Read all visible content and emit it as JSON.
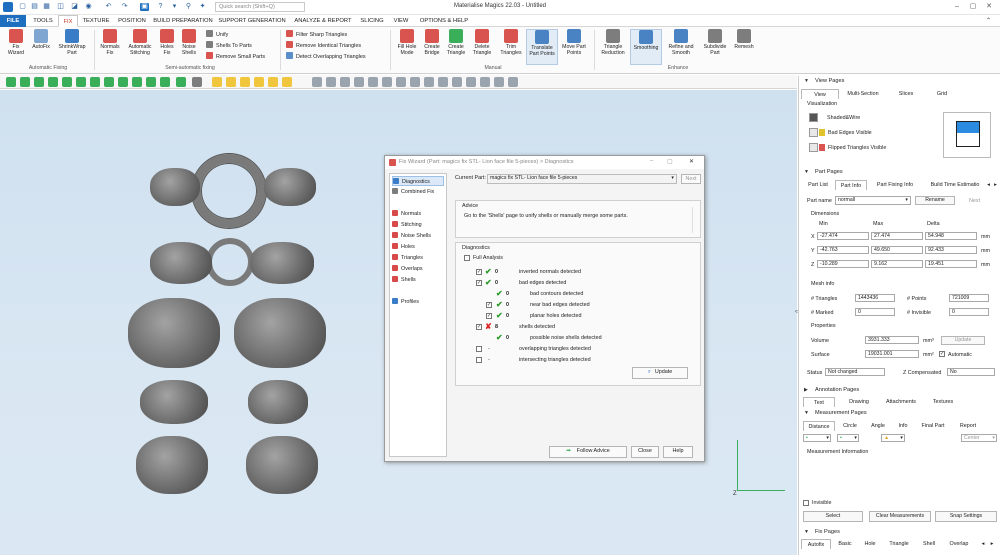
{
  "app": {
    "title": "Materialise Magics 22.03 - Untitled",
    "search_placeholder": "Quick search (Shift+Q)"
  },
  "menu_tabs": [
    "FILE",
    "TOOLS",
    "FIX",
    "TEXTURE",
    "POSITION",
    "BUILD PREPARATION",
    "SUPPORT GENERATION",
    "ANALYZE & REPORT",
    "SLICING",
    "VIEW",
    "OPTIONS & HELP"
  ],
  "ribbon": {
    "auto": [
      "Fix Wizard",
      "AutoFix",
      "ShrinkWrap Part"
    ],
    "auto_group": "Automatic Fixing",
    "semi": [
      "Normals Fix",
      "Automatic Stitching",
      "Holes Fix",
      "Noise Shells"
    ],
    "semi_small": [
      "Unify",
      "Shells To Parts",
      "Remove Small Parts"
    ],
    "semi_group": "Semi-automatic fixing",
    "filter_small": [
      "Filter Sharp Triangles",
      "Remove Identical Triangles",
      "Detect Overlapping Triangles"
    ],
    "manual": [
      "Fill Hole Mode",
      "Create Bridge",
      "Create Triangle",
      "Delete Triangle",
      "Trim Triangles",
      "Translate Part Points",
      "Move Part Points"
    ],
    "manual_group": "Manual",
    "enhance": [
      "Triangle Reduction",
      "Smoothing",
      "Refine and Smooth",
      "Subdivide Part",
      "Remesh"
    ],
    "enhance_group": "Enhance"
  },
  "dialog": {
    "title": "Fix Wizard (Part: magics fix STL- Lion face file 5-pieces) > Diagnostics",
    "nav": [
      "Diagnostics",
      "Combined Fix",
      "Normals",
      "Stitching",
      "Noise Shells",
      "Holes",
      "Triangles",
      "Overlaps",
      "Shells",
      "Profiles"
    ],
    "current_part_label": "Current Part:",
    "current_part_value": "magics fix STL- Lion face file 5-pieces",
    "next": "Next",
    "advice_label": "Advice",
    "advice_text": "Go to the 'Shells' page to unify shells or manually merge some parts.",
    "diagnostics_label": "Diagnostics",
    "full_analysis": "Full Analysis",
    "rows": [
      {
        "label": "inverted normals detected",
        "count": "0"
      },
      {
        "label": "bad edges detected",
        "count": "0"
      },
      {
        "label": "bad contours detected",
        "count": "0"
      },
      {
        "label": "near bad edges detected",
        "count": "0"
      },
      {
        "label": "planar holes detected",
        "count": "0"
      },
      {
        "label": "shells detected",
        "count": "8"
      },
      {
        "label": "possible noise shells detected",
        "count": "0"
      },
      {
        "label": "overlapping triangles detected",
        "count": "-"
      },
      {
        "label": "intersecting triangles detected",
        "count": "-"
      }
    ],
    "update": "Update",
    "follow_advice": "Follow Advice",
    "close": "Close",
    "help": "Help"
  },
  "right": {
    "view_pages": "View Pages",
    "view_tabs": [
      "View",
      "Multi-Section",
      "Slices",
      "Grid"
    ],
    "visualization": "Visualization",
    "vis_items": [
      "Shaded&Wire",
      "Bad Edges Visible",
      "Flipped Triangles Visible"
    ],
    "part_pages": "Part Pages",
    "part_tabs": [
      "Part List",
      "Part Info",
      "Part Fixing Info",
      "Build Time Estimatio"
    ],
    "part_name_label": "Part name",
    "part_name": "normall",
    "rename": "Rename",
    "next": "Next",
    "dimensions": "Dimensions",
    "dim_heads": [
      "Min",
      "Max",
      "Delta"
    ],
    "dims": [
      {
        "axis": "X",
        "min": "-27.474",
        "max": "27.474",
        "delta": "54.948",
        "unit": "mm"
      },
      {
        "axis": "Y",
        "min": "-42.763",
        "max": "49.650",
        "delta": "92.433",
        "unit": "mm"
      },
      {
        "axis": "Z",
        "min": "-10.289",
        "max": "9.162",
        "delta": "19.451",
        "unit": "mm"
      }
    ],
    "mesh_info": "Mesh info",
    "triangles_label": "# Triangles",
    "triangles": "1443436",
    "points_label": "# Points",
    "points": "721009",
    "marked_label": "# Marked",
    "marked": "0",
    "invisible_label": "# Invisible",
    "invisible": "0",
    "properties": "Properties",
    "volume_label": "Volume",
    "volume": "3931.333",
    "volume_unit": "mm³",
    "surface_label": "Surface",
    "surface": "19031.001",
    "surface_unit": "mm²",
    "automatic": "Automatic",
    "update": "Update",
    "status_label": "Status",
    "status": "Not changed",
    "zcomp_label": "Z Compensated",
    "zcomp": "No",
    "annotation_pages": "Annotation Pages",
    "annotation_tabs": [
      "Text",
      "Drawing",
      "Attachments",
      "Textures"
    ],
    "measurement_pages": "Measurement Pages",
    "meas_tabs": [
      "Distance",
      "Circle",
      "Angle",
      "Info",
      "Final Part",
      "Report"
    ],
    "center": "Center",
    "measurement_info": "Measurement Information",
    "invisible_chk": "Invisible",
    "select": "Select",
    "clear": "Clear Measurements",
    "snap": "Snap Settings",
    "fix_pages": "Fix Pages",
    "fix_tabs": [
      "Autofix",
      "Basic",
      "Hole",
      "Triangle",
      "Shell",
      "Overlap"
    ]
  },
  "axis_label": "Z"
}
